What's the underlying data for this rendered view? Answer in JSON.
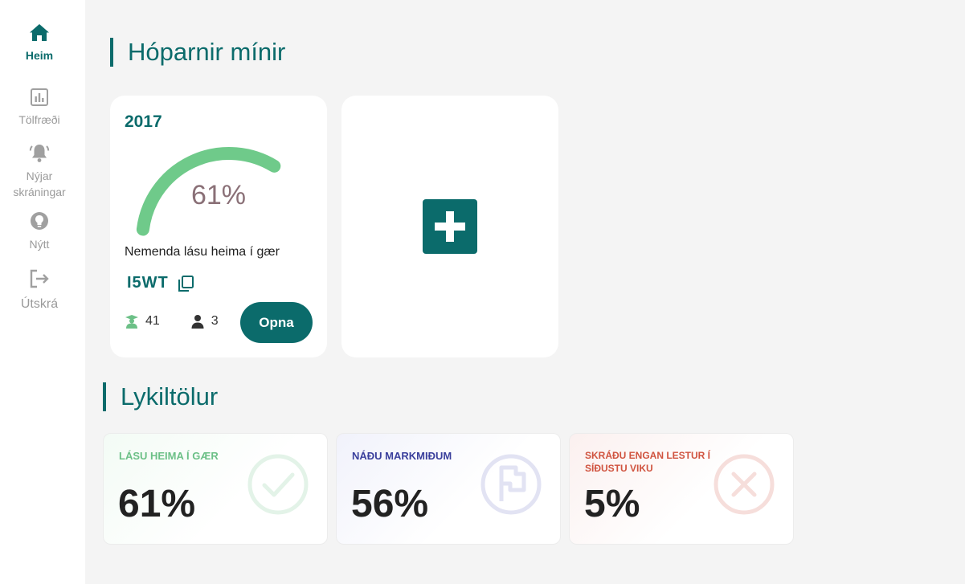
{
  "colors": {
    "brand": "#0b6b6b",
    "gauge": "#6fca8a",
    "gauge_text": "#8a7077",
    "read_label": "#6cc087",
    "goal_label": "#3a3f9c",
    "none_label": "#d0533f"
  },
  "sidebar": {
    "items": [
      {
        "label": "Heim",
        "icon": "home-icon",
        "active": true
      },
      {
        "label": "Tölfræði",
        "icon": "chart-icon"
      },
      {
        "label": "Nýjar skráningar",
        "icon": "bell-icon"
      },
      {
        "label": "Nýtt",
        "icon": "lightbulb-icon"
      },
      {
        "label": "Útskrá",
        "icon": "logout-icon"
      }
    ]
  },
  "groups": {
    "title": "Hóparnir mínir",
    "card": {
      "name": "2017",
      "percent_text": "61%",
      "percent_value": 61,
      "caption": "Nemenda lásu heima í gær",
      "code": "I5WT",
      "students": "41",
      "teachers": "3",
      "open_label": "Opna"
    },
    "add_icon": "plus-icon"
  },
  "key_figures": {
    "title": "Lykiltölur",
    "items": [
      {
        "label": "LÁSU HEIMA Í GÆR",
        "value": "61%",
        "icon": "check-circle-icon"
      },
      {
        "label": "NÁÐU MARKMIÐUM",
        "value": "56%",
        "icon": "flag-circle-icon"
      },
      {
        "label": "SKRÁÐU ENGAN LESTUR Í SÍÐUSTU VIKU",
        "value": "5%",
        "icon": "x-circle-icon"
      }
    ]
  }
}
